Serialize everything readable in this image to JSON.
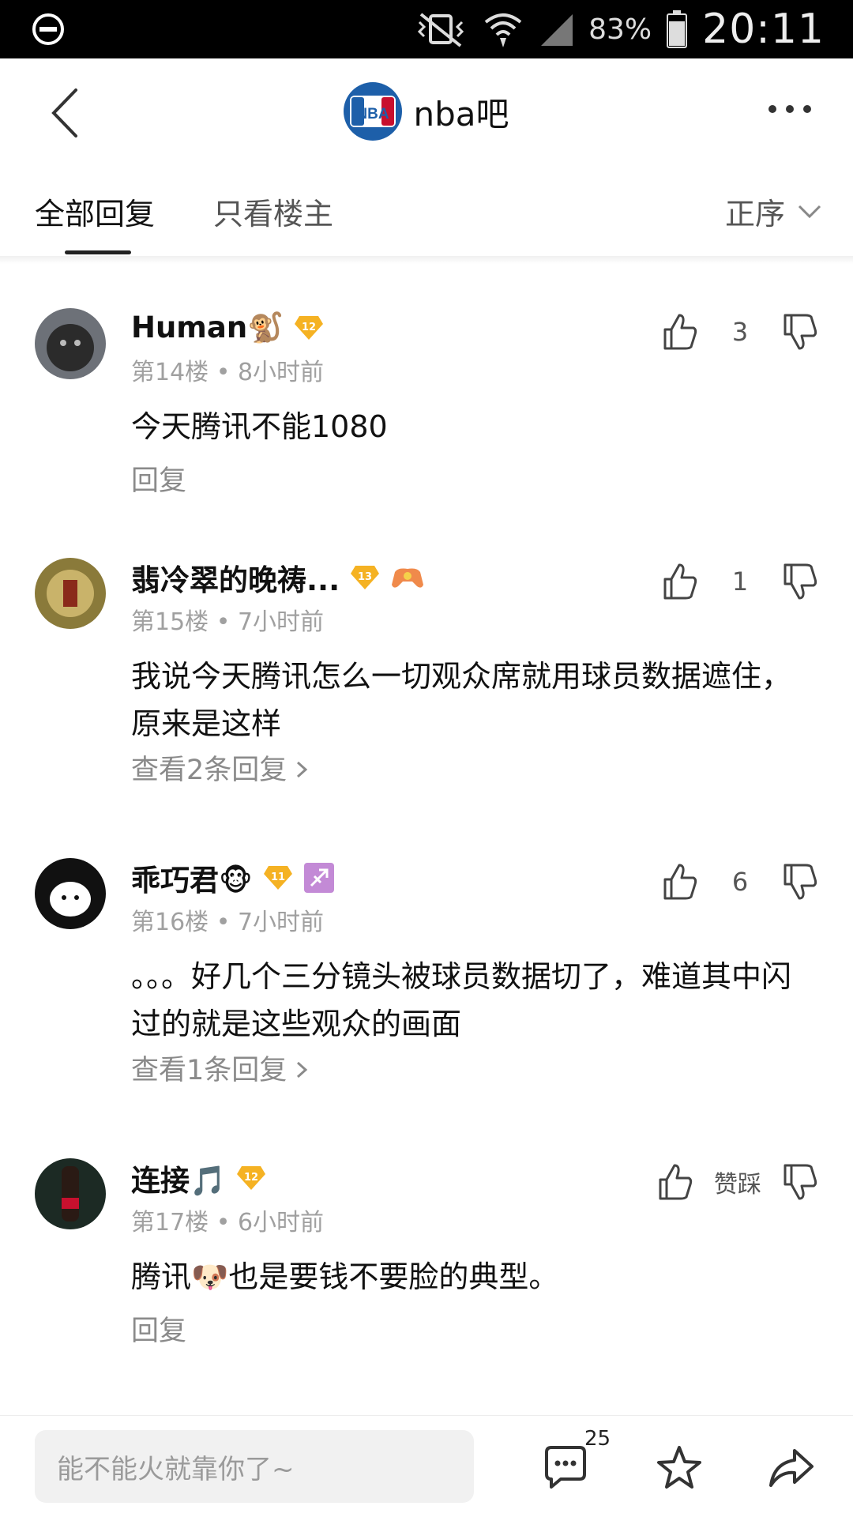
{
  "status_bar": {
    "battery_pct": "83%",
    "time": "20:11"
  },
  "header": {
    "title": "nba吧",
    "logo_text": "NBA"
  },
  "tabs": {
    "all": "全部回复",
    "owner_only": "只看楼主",
    "sort": "正序"
  },
  "comments": [
    {
      "username": "Human🐒",
      "level": "12",
      "floor": "第14楼",
      "time": "8小时前",
      "text": "今天腾讯不能1080",
      "reply": "回复",
      "likes": "3"
    },
    {
      "username": "翡冷翠的晚祷...",
      "level": "13",
      "floor": "第15楼",
      "time": "7小时前",
      "text": "我说今天腾讯怎么一切观众席就用球员数据遮住，原来是这样",
      "reply": "查看2条回复",
      "likes": "1"
    },
    {
      "username": "乖巧君🐵",
      "level": "11",
      "floor": "第16楼",
      "time": "7小时前",
      "text": "。。。好几个三分镜头被球员数据切了，难道其中闪过的就是这些观众的画面",
      "reply": "查看1条回复",
      "likes": "6"
    },
    {
      "username": "连接🎵",
      "level": "12",
      "floor": "第17楼",
      "time": "6小时前",
      "text": "腾讯🐶也是要钱不要脸的典型。",
      "reply": "回复",
      "likes": "赞踩"
    }
  ],
  "bottom": {
    "placeholder": "能不能火就靠你了~",
    "comment_count": "25"
  },
  "colors": {
    "level_badge": "#f5b223",
    "nba_blue": "#1d5fa9",
    "nba_red": "#c8102e"
  }
}
